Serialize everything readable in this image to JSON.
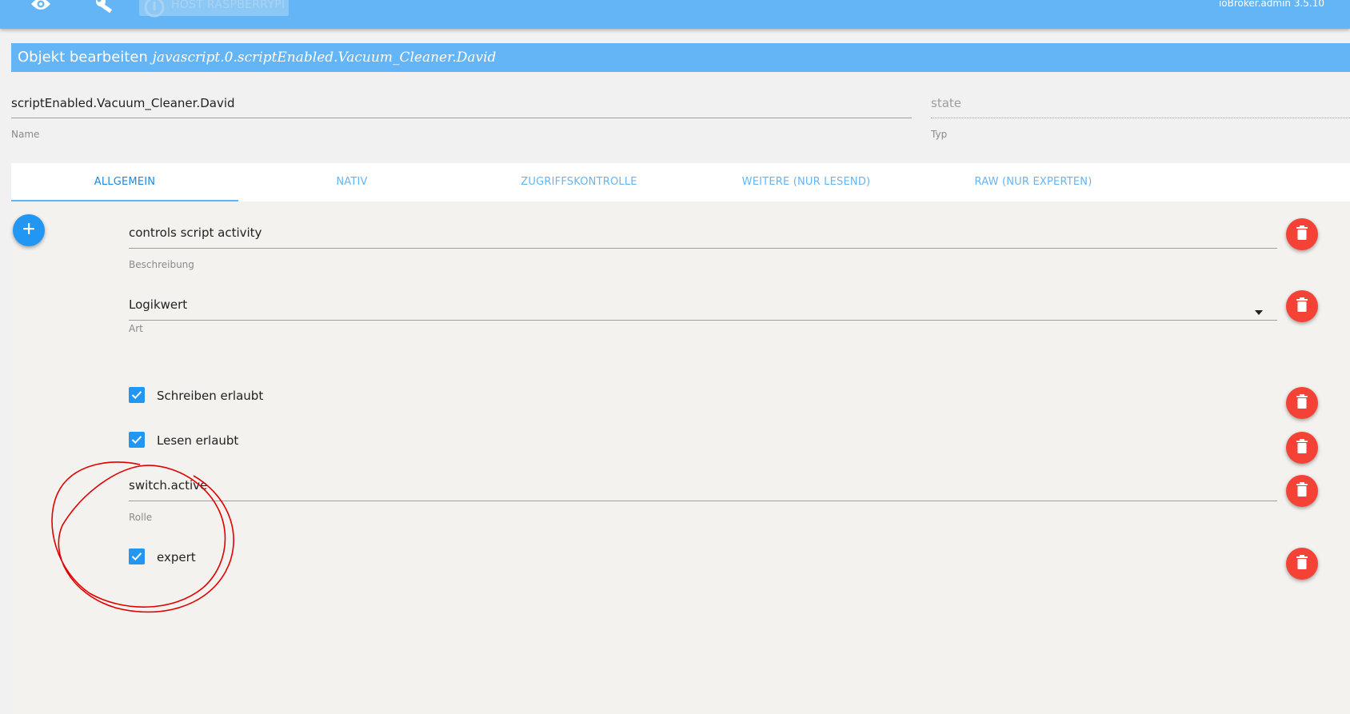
{
  "topbar": {
    "icons": [
      "eye-icon",
      "wrench-icon",
      "info-icon"
    ],
    "host_label": "HOST RASPBERRYPI",
    "version": "ioBroker.admin 3.5.10",
    "color": "#64b5f6"
  },
  "title": {
    "prefix": "Objekt bearbeiten",
    "object_id": "javascript.0.scriptEnabled.Vacuum_Cleaner.David"
  },
  "name_field": {
    "value": "scriptEnabled.Vacuum_Cleaner.David",
    "label": "Name"
  },
  "type_field": {
    "value": "state",
    "label": "Typ"
  },
  "tabs": [
    {
      "label": "ALLGEMEIN",
      "active": true
    },
    {
      "label": "NATIV",
      "active": false
    },
    {
      "label": "ZUGRIFFSKONTROLLE",
      "active": false
    },
    {
      "label": "WEITERE (NUR LESEND)",
      "active": false
    },
    {
      "label": "RAW (NUR EXPERTEN)",
      "active": false
    }
  ],
  "form": {
    "description": {
      "value": "controls script activity",
      "label": "Beschreibung"
    },
    "type_select": {
      "value": "Logikwert",
      "label": "Art"
    },
    "write_allowed": {
      "label": "Schreiben erlaubt",
      "checked": true
    },
    "read_allowed": {
      "label": "Lesen erlaubt",
      "checked": true
    },
    "role": {
      "value": "switch.active",
      "label": "Rolle"
    },
    "expert": {
      "label": "expert",
      "checked": true
    }
  },
  "colors": {
    "accent": "#64b5f6",
    "primary_button": "#2196f3",
    "delete_button": "#f44336",
    "annotation": "#e00000"
  },
  "icons": {
    "add": "plus-icon",
    "delete": "trash-icon",
    "checkbox": "check-icon",
    "dropdown": "chevron-down-icon"
  }
}
